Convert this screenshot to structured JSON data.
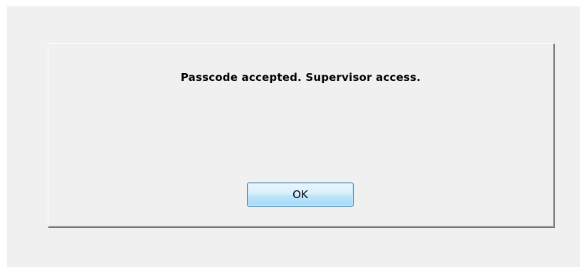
{
  "dialog": {
    "message": "Passcode accepted. Supervisor access.",
    "ok_label": "OK"
  },
  "colors": {
    "dialog_background": "#f0f0f0",
    "button_border": "#3c7fb1",
    "button_fill": "#bee6fd"
  }
}
